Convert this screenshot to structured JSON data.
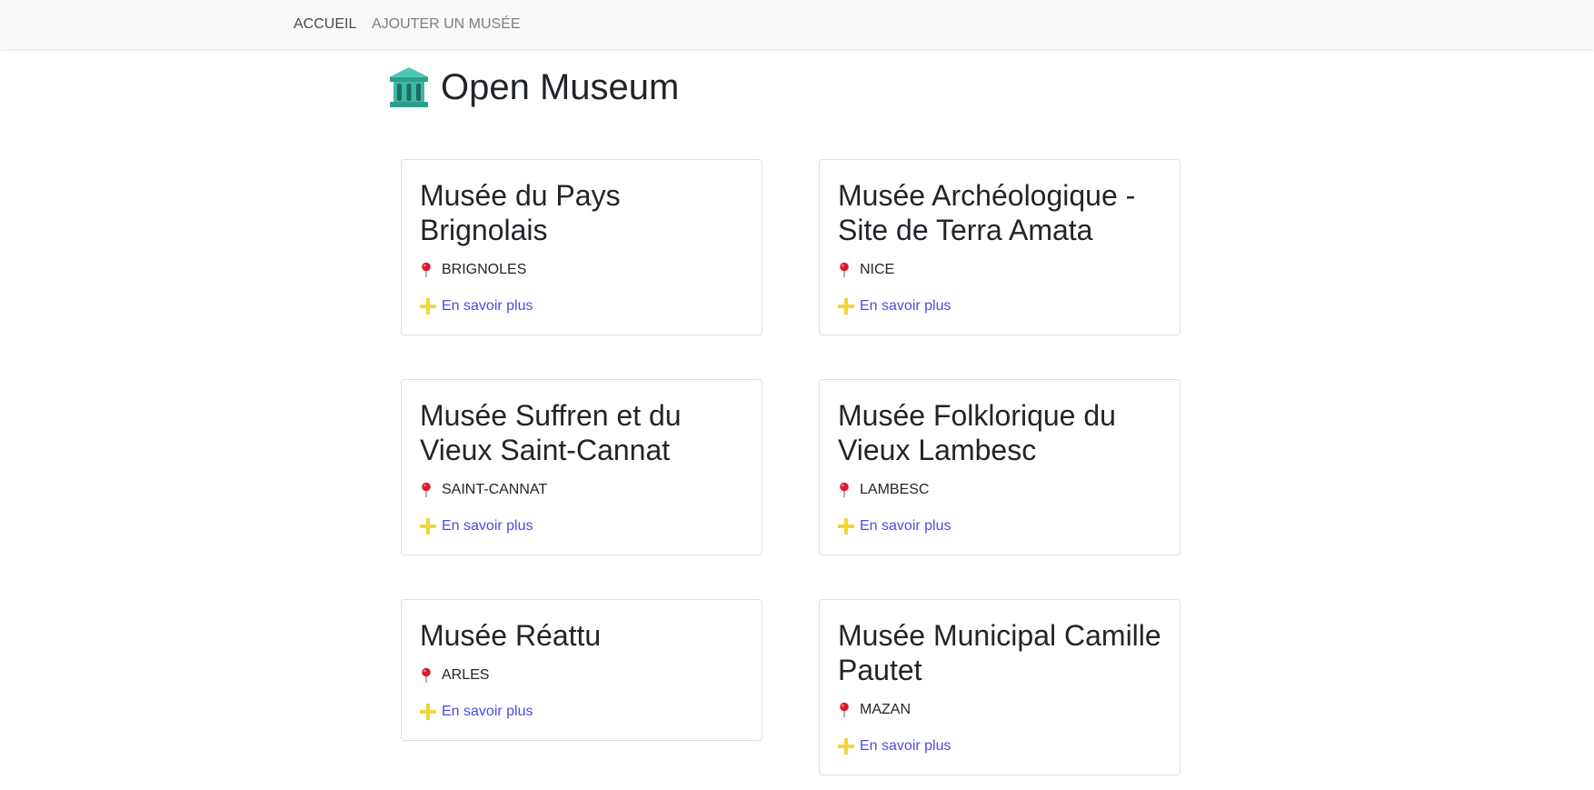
{
  "nav": {
    "home_label": "Accueil",
    "add_label": "Ajouter un musée"
  },
  "header": {
    "title": "Open Museum",
    "icon": "museum-building-icon"
  },
  "cards": [
    {
      "name": "Musée du Pays Brignolais",
      "city": "Brignoles",
      "link_label": "En savoir plus"
    },
    {
      "name": "Musée Archéologique - Site de Terra Amata",
      "city": "Nice",
      "link_label": "En savoir plus"
    },
    {
      "name": "Musée Suffren et du Vieux Saint-Cannat",
      "city": "Saint-Cannat",
      "link_label": "En savoir plus"
    },
    {
      "name": "Musée Folklorique du Vieux Lambesc",
      "city": "Lambesc",
      "link_label": "En savoir plus"
    },
    {
      "name": "Musée Réattu",
      "city": "Arles",
      "link_label": "En savoir plus"
    },
    {
      "name": "Musée Municipal Camille Pautet",
      "city": "Mazan",
      "link_label": "En savoir plus"
    }
  ],
  "colors": {
    "navbar_bg": "#f8f9fa",
    "link": "#4b4be8",
    "pin": "#d81b2a",
    "plus": "#f2d43b",
    "museum_icon": "#3fb8a6"
  }
}
